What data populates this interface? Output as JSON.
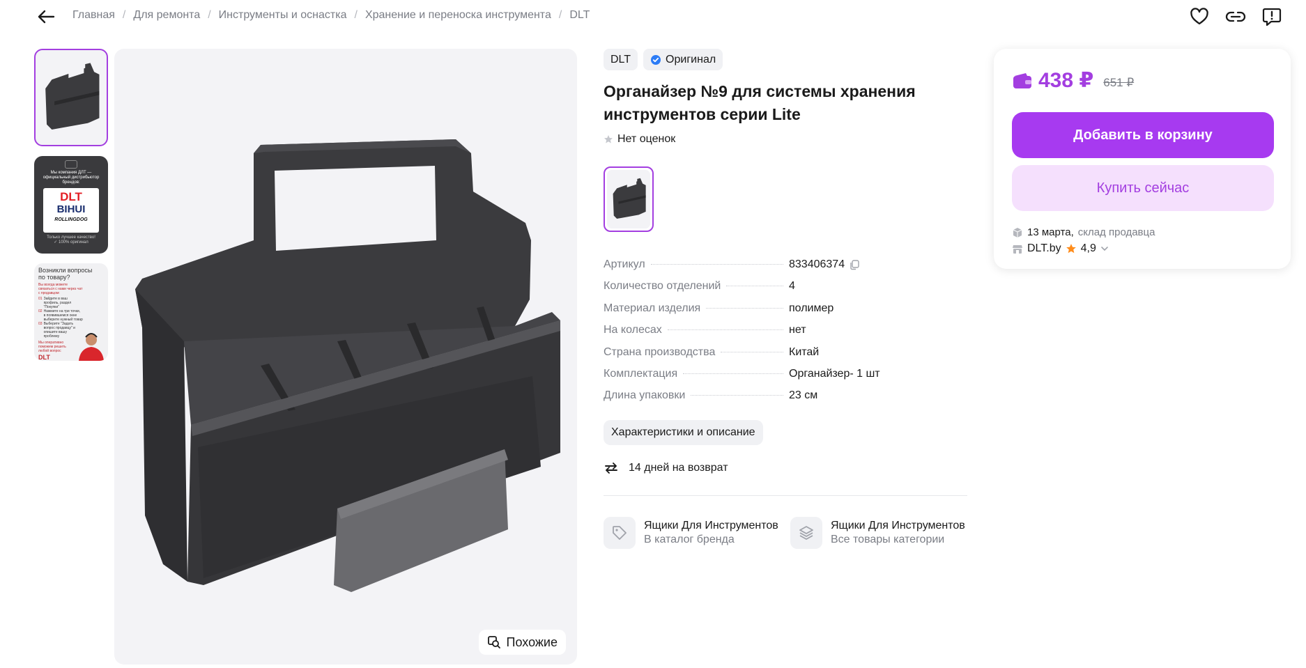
{
  "breadcrumb": [
    "Главная",
    "Для ремонта",
    "Инструменты и оснастка",
    "Хранение и переноска инструмента",
    "DLT"
  ],
  "breadcrumb_separator": "/",
  "gallery": {
    "thumb2": {
      "lines": [
        "Мы компания ДЛТ —",
        "официальный дистрибьютор",
        "брендов:"
      ],
      "brand1": "DLT",
      "brand2": "BIHUI",
      "brand3": "ROLLINGDOG",
      "footer": [
        "Только лучшее качество!",
        "✓ 100% оригинал"
      ]
    },
    "thumb3": {
      "title": [
        "Возникли вопросы",
        "по товару?"
      ],
      "intro": "Вы всегда можете связаться с нами через чат с продавцом:",
      "steps": [
        "Зайдите в ваш профиль, раздел \"Покупки\"",
        "Нажмите на три точки, в появившемся окне выберите нужный товар",
        "Выберите \"Задать вопрос продавцу\" и опишите вашу проблему"
      ],
      "outro": "Мы оперативно поможем решить любой вопрос",
      "logo": "DLT"
    },
    "similar_label": "Похожие"
  },
  "product": {
    "brand": "DLT",
    "original_label": "Оригинал",
    "title": "Органайзер №9 для системы хранения инструментов серии Lite",
    "rating_text": "Нет оценок",
    "specs": [
      {
        "key": "Артикул",
        "value": "833406374"
      },
      {
        "key": "Количество отделений",
        "value": "4"
      },
      {
        "key": "Материал изделия",
        "value": "полимер"
      },
      {
        "key": "На колесах",
        "value": "нет"
      },
      {
        "key": "Страна производства",
        "value": "Китай"
      },
      {
        "key": "Комплектация",
        "value": "Органайзер- 1 шт"
      },
      {
        "key": "Длина упаковки",
        "value": "23 см"
      }
    ],
    "desc_button": "Характеристики и описание",
    "returns": "14 дней на возврат",
    "links": [
      {
        "title": "Ящики Для Инструментов DLT",
        "subtitle": "В каталог бренда"
      },
      {
        "title": "Ящики Для Инструментов",
        "subtitle": "Все товары категории"
      }
    ]
  },
  "price_card": {
    "price": "438 ₽",
    "old_price": "651 ₽",
    "add_to_cart": "Добавить в корзину",
    "buy_now": "Купить сейчас",
    "delivery_date": "13 марта,",
    "delivery_source": "склад продавца",
    "seller_name": "DLT.by",
    "seller_rating": "4,9"
  },
  "colors": {
    "accent": "#a33ee0",
    "accent_light": "#f5e0fd",
    "muted_text": "#7a7d85",
    "chip_bg": "#f0f1f4",
    "product_color": "#3b3b3e",
    "star": "#ff8c1a"
  },
  "icons": {
    "back": "arrow-left-icon",
    "favorite": "heart-icon",
    "share": "link-icon",
    "report": "chat-alert-icon",
    "verified": "verified-check-icon",
    "rating_star": "star-icon",
    "copy": "copy-icon",
    "returns": "arrows-swap-icon",
    "brand_link": "tag-icon",
    "category_link": "layers-icon",
    "similar": "similar-search-icon",
    "wallet": "wallet-icon",
    "box": "box-icon",
    "shop": "shop-icon",
    "chevron": "chevron-down-icon"
  }
}
